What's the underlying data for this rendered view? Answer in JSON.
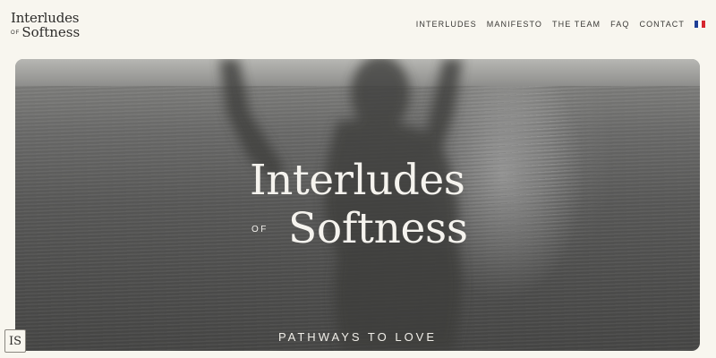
{
  "brand": {
    "logo_line1": "Interludes",
    "logo_of": "OF",
    "logo_line2": "Softness",
    "badge_initials": "IS"
  },
  "nav": {
    "items": [
      {
        "label": "INTERLUDES"
      },
      {
        "label": "MANIFESTO"
      },
      {
        "label": "THE TEAM"
      },
      {
        "label": "FAQ"
      },
      {
        "label": "CONTACT"
      }
    ],
    "language_flag": "france-flag-icon",
    "flag_colors": [
      "#1f3f96",
      "#ffffff",
      "#d6272f"
    ]
  },
  "hero": {
    "title_line1": "Interludes",
    "title_of": "OF",
    "title_line2": "Softness",
    "tagline": "PATHWAYS TO LOVE"
  },
  "colors": {
    "background": "#f8f6ef",
    "text": "#2b2a28",
    "hero_text": "#f5f3ee"
  }
}
